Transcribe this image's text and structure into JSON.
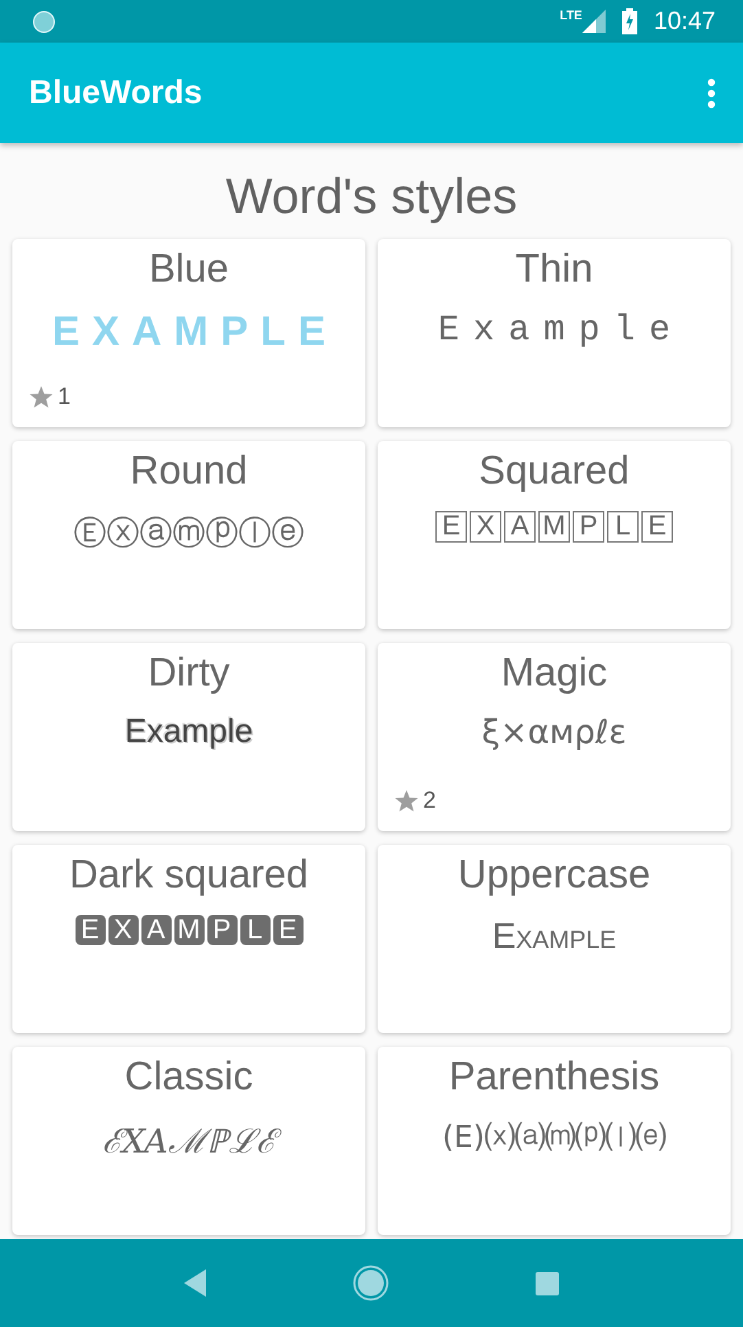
{
  "status_bar": {
    "network": "LTE",
    "time": "10:47"
  },
  "app_bar": {
    "title": "BlueWords"
  },
  "heading": "Word's styles",
  "cards": [
    {
      "title": "Blue",
      "kind": "blue",
      "example": "EXAMPLE",
      "favorites": "1"
    },
    {
      "title": "Thin",
      "kind": "thin",
      "example": "Example"
    },
    {
      "title": "Round",
      "kind": "round",
      "example": "Ⓔⓧⓐⓜⓟⓛⓔ"
    },
    {
      "title": "Squared",
      "kind": "squared",
      "letters": [
        "E",
        "X",
        "A",
        "M",
        "P",
        "L",
        "E"
      ]
    },
    {
      "title": "Dirty",
      "kind": "dirty",
      "example": "Example"
    },
    {
      "title": "Magic",
      "kind": "magic",
      "example": "ξ×αмρℓε",
      "favorites": "2"
    },
    {
      "title": "Dark squared",
      "kind": "dark_squared",
      "letters": [
        "E",
        "X",
        "A",
        "M",
        "P",
        "L",
        "E"
      ]
    },
    {
      "title": "Uppercase",
      "kind": "uppercase",
      "example": "Example"
    },
    {
      "title": "Classic",
      "kind": "classic",
      "example": "ℰXAℳℙℒℰ"
    },
    {
      "title": "Parenthesis",
      "kind": "parenthesis",
      "example": "(E)⒳⒜⒨⒫⒧⒠"
    }
  ]
}
